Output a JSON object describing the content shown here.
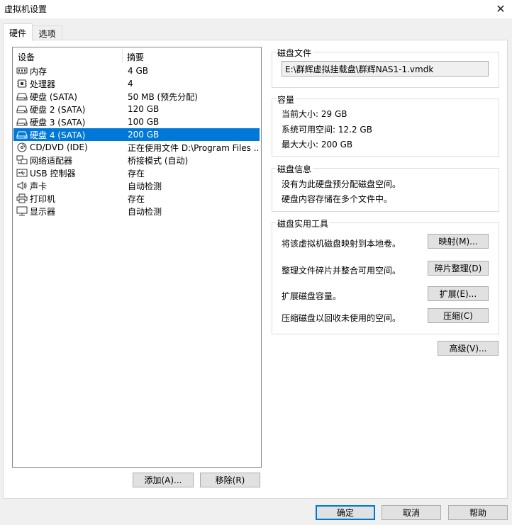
{
  "window": {
    "title": "虚拟机设置",
    "close_glyph": "✕"
  },
  "tabs": [
    {
      "label": "硬件"
    },
    {
      "label": "选项"
    }
  ],
  "device_list": {
    "headers": {
      "device": "设备",
      "summary": "摘要"
    },
    "rows": [
      {
        "icon": "memory-icon",
        "device": "内存",
        "summary": "4 GB"
      },
      {
        "icon": "processor-icon",
        "device": "处理器",
        "summary": "4"
      },
      {
        "icon": "hard-disk-icon",
        "device": "硬盘 (SATA)",
        "summary": "50 MB (预先分配)"
      },
      {
        "icon": "hard-disk-icon",
        "device": "硬盘 2 (SATA)",
        "summary": "120 GB"
      },
      {
        "icon": "hard-disk-icon",
        "device": "硬盘 3 (SATA)",
        "summary": "100 GB"
      },
      {
        "icon": "hard-disk-icon",
        "device": "硬盘 4 (SATA)",
        "summary": "200 GB",
        "selected": true
      },
      {
        "icon": "cd-dvd-icon",
        "device": "CD/DVD (IDE)",
        "summary": "正在使用文件 D:\\Program Files ..."
      },
      {
        "icon": "network-adapter-icon",
        "device": "网络适配器",
        "summary": "桥接模式 (自动)"
      },
      {
        "icon": "usb-icon",
        "device": "USB 控制器",
        "summary": "存在"
      },
      {
        "icon": "sound-icon",
        "device": "声卡",
        "summary": "自动检测"
      },
      {
        "icon": "printer-icon",
        "device": "打印机",
        "summary": "存在"
      },
      {
        "icon": "display-icon",
        "device": "显示器",
        "summary": "自动检测"
      }
    ]
  },
  "list_buttons": {
    "add": "添加(A)...",
    "remove": "移除(R)"
  },
  "disk_file": {
    "label": "磁盘文件",
    "path": "E:\\群辉虚拟挂载盘\\群辉NAS1-1.vmdk"
  },
  "capacity": {
    "label": "容量",
    "current": "当前大小: 29 GB",
    "available": "系统可用空间: 12.2 GB",
    "max": "最大大小: 200 GB"
  },
  "disk_info": {
    "label": "磁盘信息",
    "line1": "没有为此硬盘预分配磁盘空间。",
    "line2": "硬盘内容存储在多个文件中。"
  },
  "disk_utilities": {
    "label": "磁盘实用工具",
    "map_desc": "将该虚拟机磁盘映射到本地卷。",
    "map_btn": "映射(M)...",
    "defrag_desc": "整理文件碎片并整合可用空间。",
    "defrag_btn": "碎片整理(D)",
    "expand_desc": "扩展磁盘容量。",
    "expand_btn": "扩展(E)...",
    "compact_desc": "压缩磁盘以回收未使用的空间。",
    "compact_btn": "压缩(C)"
  },
  "advanced_btn": "高级(V)...",
  "footer": {
    "ok": "确定",
    "cancel": "取消",
    "help": "帮助"
  },
  "colors": {
    "selection": "#0078d7",
    "window_bg": "#f0f0f0",
    "panel_bg": "#ffffff"
  }
}
